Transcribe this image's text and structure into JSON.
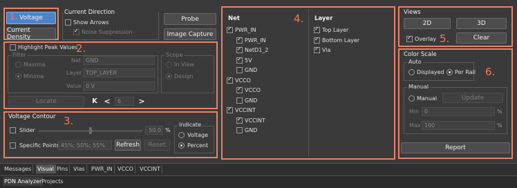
{
  "markers": [
    "1.",
    "2.",
    "3.",
    "4.",
    "5.",
    "6."
  ],
  "region1": {
    "voltage_btn": "Voltage",
    "current_density_btn": "Current Density",
    "current_direction_title": "Current Direction",
    "show_arrows": "Show Arrows",
    "noise_suppression": "Noise Suppression",
    "probe_btn": "Probe",
    "image_capture_btn": "Image Capture"
  },
  "region2": {
    "highlight_peak": "Highlight Peak Values",
    "filter_title": "Filter",
    "maxima": "Maxima",
    "minima": "Minima",
    "net_label": "Net",
    "net_value": "GND",
    "layer_label": "Layer",
    "layer_value": "TOP_LAYER",
    "value_label": "Value",
    "value_value": "0 V",
    "scope_title": "Scope",
    "in_view": "In View",
    "design": "Design",
    "locate_btn": "Locate",
    "nav_first": "K",
    "nav_prev": "<",
    "nav_index": "6",
    "nav_next": ">"
  },
  "region3": {
    "title": "Voltage Contour",
    "slider_label": "Slider",
    "slider_value": "50.0",
    "slider_unit": "%",
    "slider_level": 0.5,
    "specific_points": "Specific Points",
    "specific_values": "45%; 50%; 55%",
    "refresh_btn": "Refresh",
    "reset_btn": "Reset",
    "indicate_title": "Indicate",
    "indicate_voltage": "Voltage",
    "indicate_percent": "Percent"
  },
  "region4": {
    "net_header": "Net",
    "layer_header": "Layer",
    "nets": [
      {
        "label": "PWR_IN",
        "checked": true,
        "indent": 0
      },
      {
        "label": "PWR_IN",
        "checked": true,
        "indent": 1
      },
      {
        "label": "NetD1_2",
        "checked": true,
        "indent": 1
      },
      {
        "label": "5V",
        "checked": true,
        "indent": 1
      },
      {
        "label": "GND",
        "checked": false,
        "indent": 1
      },
      {
        "label": "VCCO",
        "checked": true,
        "indent": 0
      },
      {
        "label": "VCCO",
        "checked": true,
        "indent": 1
      },
      {
        "label": "GND",
        "checked": false,
        "indent": 1
      },
      {
        "label": "VCCINT",
        "checked": true,
        "indent": 0
      },
      {
        "label": "VCCINT",
        "checked": true,
        "indent": 1
      },
      {
        "label": "GND",
        "checked": false,
        "indent": 1
      }
    ],
    "layers": [
      {
        "label": "Top Layer",
        "checked": true
      },
      {
        "label": "Bottom Layer",
        "checked": true
      },
      {
        "label": "Via",
        "checked": true
      }
    ]
  },
  "region5": {
    "title": "Views",
    "btn_2d": "2D",
    "btn_3d": "3D",
    "overlay": "Overlay",
    "clear_btn": "Clear"
  },
  "region6": {
    "title": "Color Scale",
    "auto_title": "Auto",
    "displayed": "Displayed",
    "per_rail": "Per Rail",
    "manual_title": "Manual",
    "manual_radio": "Manual",
    "update_btn": "Update",
    "min_label": "Min",
    "min_value": "0",
    "max_label": "Max",
    "max_value": "100",
    "unit": "%",
    "report_btn": "Report"
  },
  "tabs": [
    "Messages",
    "Visual",
    "Pins",
    "Vias",
    "PWR_IN",
    "VCCO",
    "VCCINT"
  ],
  "bottom_tabs": [
    "PDN Analyzer",
    "Projects"
  ]
}
